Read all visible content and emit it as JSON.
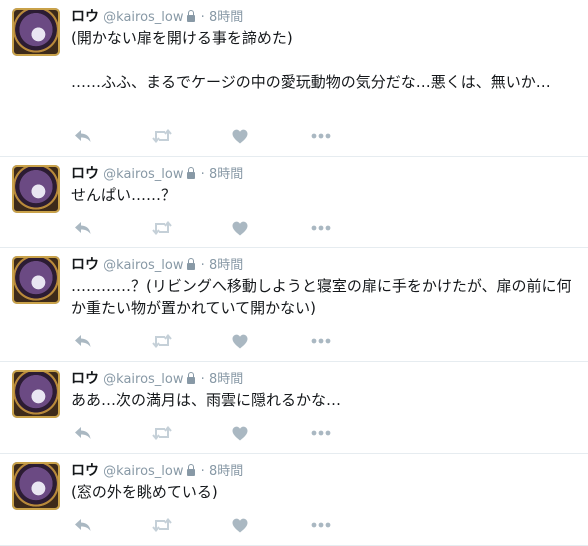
{
  "tweets": [
    {
      "name": "ロウ",
      "handle": "@kairos_low",
      "time": "8時間",
      "text": "(開かない扉を開ける事を諦めた)\n\n……ふふ、まるでケージの中の愛玩動物の気分だな…悪くは、無いか…"
    },
    {
      "name": "ロウ",
      "handle": "@kairos_low",
      "time": "8時間",
      "text": "せんぱい……？"
    },
    {
      "name": "ロウ",
      "handle": "@kairos_low",
      "time": "8時間",
      "text": "…………？(リビングへ移動しようと寝室の扉に手をかけたが、扉の前に何か重たい物が置かれていて開かない)"
    },
    {
      "name": "ロウ",
      "handle": "@kairos_low",
      "time": "8時間",
      "text": "ああ…次の満月は、雨雲に隠れるかな…"
    },
    {
      "name": "ロウ",
      "handle": "@kairos_low",
      "time": "8時間",
      "text": "(窓の外を眺めている)"
    }
  ],
  "separator": "·",
  "icons": [
    "reply-icon",
    "retweet-icon",
    "like-icon",
    "more-icon",
    "lock-icon"
  ]
}
